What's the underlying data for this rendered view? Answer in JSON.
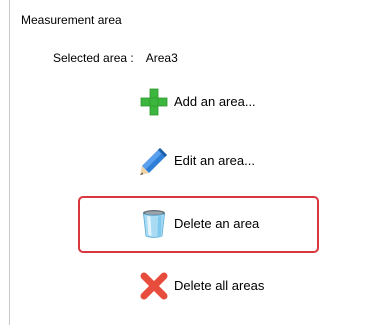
{
  "group": {
    "title": "Measurement area"
  },
  "selection": {
    "label": "Selected area :",
    "value": "Area3"
  },
  "actions": [
    {
      "label": "Add an area...",
      "icon": "plus-icon",
      "color": "#3cb63c"
    },
    {
      "label": "Edit an area...",
      "icon": "pencil-icon",
      "color": "#2f7fd8"
    },
    {
      "label": "Delete an area",
      "icon": "trash-can-icon",
      "color": "#7fc8ee",
      "highlighted": true,
      "highlight_color": "#d9363e"
    },
    {
      "label": "Delete all areas",
      "icon": "red-x-icon",
      "color": "#e84c3d"
    }
  ]
}
